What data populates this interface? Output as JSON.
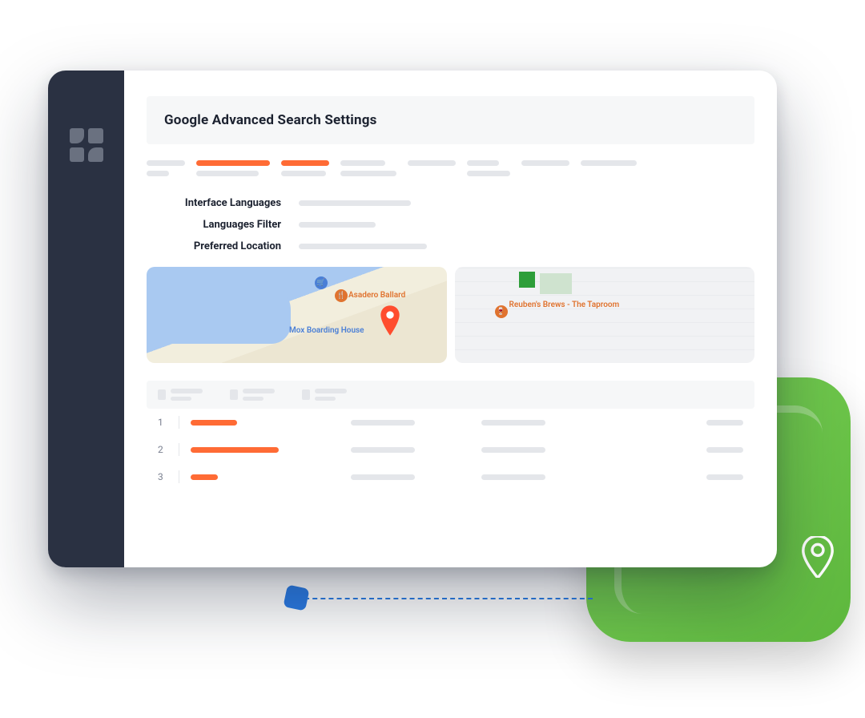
{
  "title": "Google Advanced Search Settings",
  "settings": {
    "interface_languages": "Interface Languages",
    "languages_filter": "Languages Filter",
    "preferred_location": "Preferred Location"
  },
  "map": {
    "poi1": "Asadero Ballard",
    "poi2": "Mox Boarding House",
    "poi3": "Reuben's Brews - The Taproom"
  },
  "table": {
    "rows": [
      "1",
      "2",
      "3"
    ]
  }
}
